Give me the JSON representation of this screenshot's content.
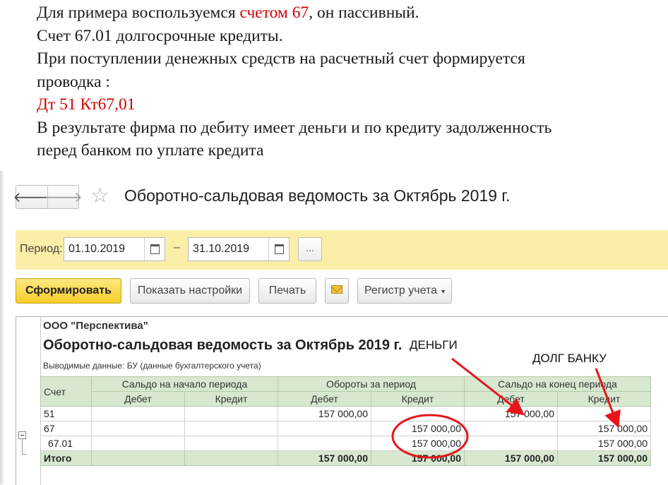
{
  "slide": {
    "line1_before": "Для примера воспользуемся ",
    "line1_red": "счетом 67",
    "line1_after": ", он пассивный.",
    "line2": "Счет 67.01 долгосрочные кредиты.",
    "line3": "При поступлении денежных средств на расчетный счет  формируется",
    "line4": "проводка :",
    "line5_red": "Дт 51 Кт67,01",
    "line6": "В результате фирма по дебиту имеет деньги и по кредиту задолженность",
    "line7": "перед банком по уплате кредита"
  },
  "window": {
    "back_icon": "arrow-left",
    "forward_icon": "arrow-right",
    "favorite_icon": "star",
    "title": "Оборотно-сальдовая ведомость за Октябрь 2019 г."
  },
  "period": {
    "label": "Период:",
    "from": "01.10.2019",
    "dash": "–",
    "to": "31.10.2019",
    "more_label": "..."
  },
  "toolbar": {
    "generate_label": "Сформировать",
    "settings_label": "Показать настройки",
    "print_label": "Печать",
    "mail_icon": "envelope",
    "registry_label": "Регистр учета",
    "registry_caret": "▾"
  },
  "report": {
    "org": "ООО \"Перспектива\"",
    "title": "Оборотно-сальдовая ведомость за Октябрь 2019 г.",
    "subtitle": "Выводимые данные:  БУ (данные бухгалтерского учета)",
    "headers": {
      "account": "Счет",
      "opening": "Сальдо на начало периода",
      "turnover": "Обороты за период",
      "closing": "Сальдо на конец периода",
      "debit": "Дебет",
      "credit": "Кредит"
    },
    "rows": [
      {
        "account": "51",
        "open_dt": "",
        "open_kt": "",
        "turn_dt": "157 000,00",
        "turn_kt": "",
        "close_dt": "157 000,00",
        "close_kt": ""
      },
      {
        "account": "67",
        "open_dt": "",
        "open_kt": "",
        "turn_dt": "",
        "turn_kt": "157 000,00",
        "close_dt": "",
        "close_kt": "157 000,00"
      },
      {
        "account": "67.01",
        "open_dt": "",
        "open_kt": "",
        "turn_dt": "",
        "turn_kt": "157 000,00",
        "close_dt": "",
        "close_kt": "157 000,00"
      }
    ],
    "total": {
      "label": "Итого",
      "open_dt": "",
      "open_kt": "",
      "turn_dt": "157 000,00",
      "turn_kt": "157 000,00",
      "close_dt": "157 000,00",
      "close_kt": "157 000,00"
    }
  },
  "annotations": {
    "money": "ДЕНЬГИ",
    "bank_debt": "ДОЛГ БАНКУ",
    "accent_color": "#e8141a"
  }
}
